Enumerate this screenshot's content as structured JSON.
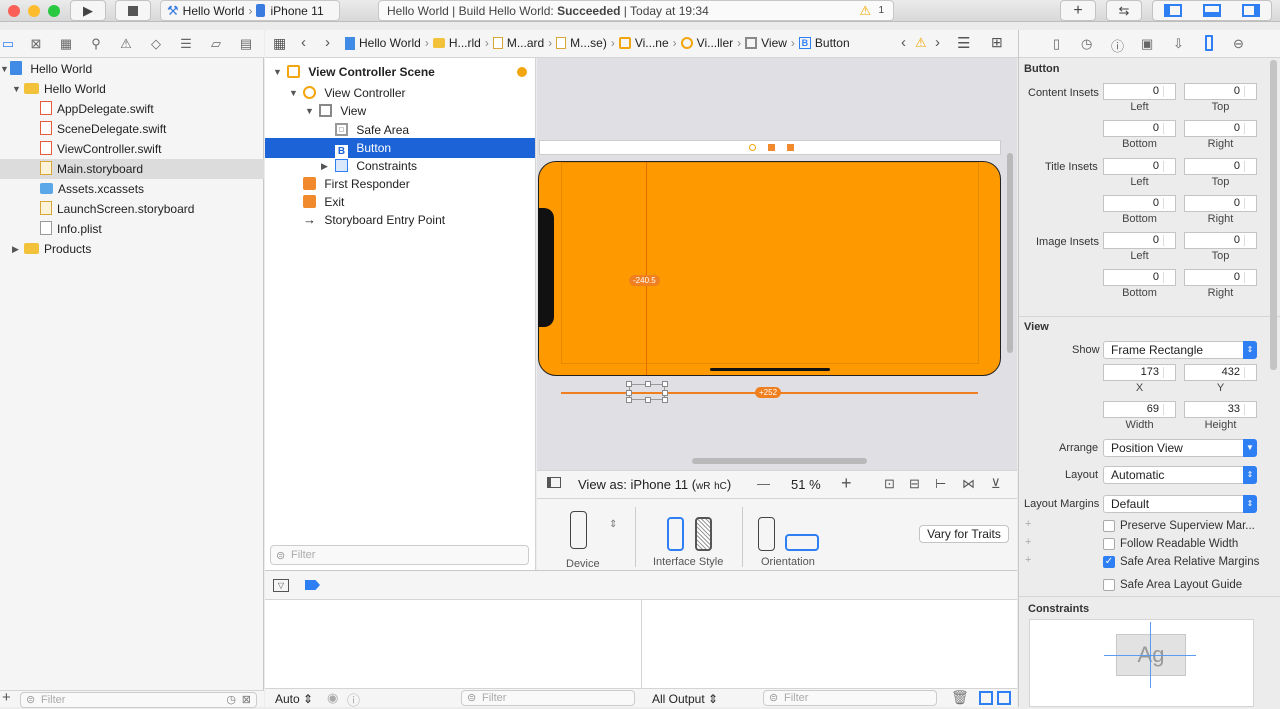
{
  "toolbar": {
    "scheme_target": "Hello World",
    "scheme_device": "iPhone 11",
    "status_prefix": "Hello World | Build Hello World: ",
    "status_result": "Succeeded",
    "status_time": " | Today at 19:34",
    "warning_count": "1"
  },
  "navigator": {
    "items": [
      {
        "label": "Hello World",
        "kind": "project"
      },
      {
        "label": "Hello World",
        "kind": "folder"
      },
      {
        "label": "AppDelegate.swift",
        "kind": "swift"
      },
      {
        "label": "SceneDelegate.swift",
        "kind": "swift"
      },
      {
        "label": "ViewController.swift",
        "kind": "swift"
      },
      {
        "label": "Main.storyboard",
        "kind": "storyboard"
      },
      {
        "label": "Assets.xcassets",
        "kind": "assets"
      },
      {
        "label": "LaunchScreen.storyboard",
        "kind": "storyboard"
      },
      {
        "label": "Info.plist",
        "kind": "plist"
      },
      {
        "label": "Products",
        "kind": "folder"
      }
    ],
    "filter_placeholder": "Filter"
  },
  "jumpbar": {
    "crumbs": [
      "Hello World",
      "H...rld",
      "M...ard",
      "M...se)",
      "Vi...ne",
      "Vi...ller",
      "View",
      "Button"
    ]
  },
  "outline": {
    "items": [
      {
        "label": "View Controller Scene"
      },
      {
        "label": "View Controller"
      },
      {
        "label": "View"
      },
      {
        "label": "Safe Area"
      },
      {
        "label": "Button"
      },
      {
        "label": "Constraints"
      },
      {
        "label": "First Responder"
      },
      {
        "label": "Exit"
      },
      {
        "label": "Storyboard Entry Point"
      }
    ],
    "filter_placeholder": "Filter"
  },
  "canvas": {
    "measure_vertical": "-240.5",
    "measure_horizontal": "+252"
  },
  "viewas": {
    "label": "View as: iPhone 11 (",
    "w": "wR",
    "h": "hC",
    "close": ")",
    "zoom": "51 %",
    "minus": "—",
    "plus": "+"
  },
  "devicebar": {
    "device": "Device",
    "interface_style": "Interface Style",
    "orientation": "Orientation",
    "vary_button": "Vary for Traits"
  },
  "debug": {
    "auto": "Auto",
    "all_output": "All Output",
    "filter_placeholder": "Filter"
  },
  "inspector": {
    "button_header": "Button",
    "content_insets": "Content Insets",
    "title_insets": "Title Insets",
    "image_insets": "Image Insets",
    "left": "Left",
    "top": "Top",
    "bottom": "Bottom",
    "right": "Right",
    "zero": "0",
    "view_header": "View",
    "show_label": "Show",
    "show_value": "Frame Rectangle",
    "x_value": "173",
    "y_value": "432",
    "x_label": "X",
    "y_label": "Y",
    "width_value": "69",
    "height_value": "33",
    "width_label": "Width",
    "height_label": "Height",
    "arrange_label": "Arrange",
    "arrange_value": "Position View",
    "layout_label": "Layout",
    "layout_value": "Automatic",
    "margins_label": "Layout Margins",
    "margins_value": "Default",
    "preserve": "Preserve Superview Mar...",
    "readable": "Follow Readable Width",
    "safe_rel": "Safe Area Relative Margins",
    "safe_guide": "Safe Area Layout Guide",
    "constraints_header": "Constraints",
    "ag": "Ag"
  }
}
